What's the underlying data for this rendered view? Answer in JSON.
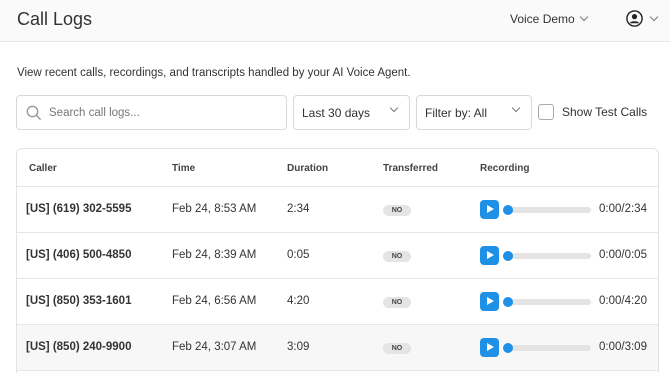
{
  "header": {
    "title": "Call Logs",
    "workspace": "Voice Demo"
  },
  "subtitle": "View recent calls, recordings, and transcripts handled by your AI Voice Agent.",
  "search": {
    "placeholder": "Search call logs..."
  },
  "filters": {
    "range": "Last 30 days",
    "filter": "Filter by: All",
    "test_calls_label": "Show Test Calls",
    "test_calls_checked": false
  },
  "table": {
    "columns": [
      "Caller",
      "Time",
      "Duration",
      "Transferred",
      "Recording"
    ],
    "rows": [
      {
        "caller": "[US] (619) 302-5595",
        "time": "Feb 24, 8:53 AM",
        "duration": "2:34",
        "transferred": "NO",
        "position": "0:00",
        "total": "/2:34"
      },
      {
        "caller": "[US] (406) 500-4850",
        "time": "Feb 24, 8:39 AM",
        "duration": "0:05",
        "transferred": "NO",
        "position": "0:00",
        "total": "/0:05"
      },
      {
        "caller": "[US] (850) 353-1601",
        "time": "Feb 24, 6:56 AM",
        "duration": "4:20",
        "transferred": "NO",
        "position": "0:00",
        "total": "/4:20"
      },
      {
        "caller": "[US] (850) 240-9900",
        "time": "Feb 24, 3:07 AM",
        "duration": "3:09",
        "transferred": "NO",
        "position": "0:00",
        "total": "/3:09"
      }
    ]
  },
  "icons": {
    "search": "search-icon",
    "user": "user-account-icon",
    "chevron": "chevron-down-icon",
    "play": "play-icon"
  },
  "colors": {
    "accent": "#1e90e6",
    "badge_bg": "#e4e4e4",
    "header_bg": "#fafafa"
  }
}
